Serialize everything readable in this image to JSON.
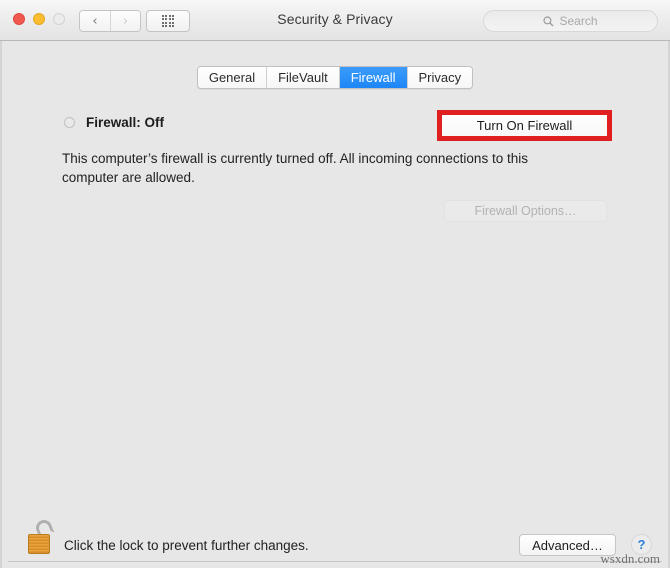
{
  "window": {
    "title": "Security & Privacy",
    "traffic_lights": [
      {
        "name": "close",
        "color": "#f1584f"
      },
      {
        "name": "minimize",
        "color": "#fbbd2f"
      },
      {
        "name": "zoom",
        "color": "#ececec"
      }
    ],
    "nav": {
      "back": "‹",
      "forward": "›"
    },
    "grid_button": "show-all-icon",
    "search": {
      "placeholder": "Search",
      "value": "",
      "icon": "search-icon"
    }
  },
  "tabs": [
    {
      "label": "General",
      "selected": false
    },
    {
      "label": "FileVault",
      "selected": false
    },
    {
      "label": "Firewall",
      "selected": true
    },
    {
      "label": "Privacy",
      "selected": false
    }
  ],
  "main": {
    "status_label": "Firewall: Off",
    "status_indicator": "off-led-icon",
    "description": "This computer’s firewall is currently turned off. All incoming connections to this computer are allowed.",
    "turn_on_button": "Turn On Firewall",
    "firewall_options_button": "Firewall Options…",
    "firewall_options_disabled": true,
    "annotation": {
      "shape": "rectangle",
      "color": "#e02020",
      "target": "Turn On Firewall"
    }
  },
  "footer": {
    "lock_icon": "unlocked-padlock-icon",
    "lock_text": "Click the lock to prevent further changes.",
    "advanced_button": "Advanced…",
    "help_button": "?"
  },
  "watermark": "wsxdn.com",
  "colors": {
    "accent_blue": "#1d86f6",
    "annotation_red": "#e02020",
    "window_bg": "#e7e7e7",
    "lock_gold": "#e9a33c"
  }
}
